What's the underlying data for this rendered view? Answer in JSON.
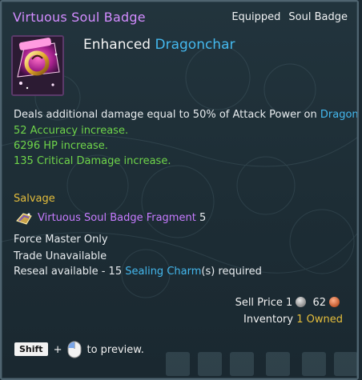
{
  "header": {
    "title": "Virtuous Soul Badge",
    "status": "Equipped",
    "type": "Soul Badge"
  },
  "item": {
    "prefix": "Enhanced",
    "name_highlight": "Dragonchar",
    "icon": "soul-badge-icon"
  },
  "effects": {
    "description_prefix": "Deals additional damage equal to 50% of Attack Power on",
    "description_highlight": "Dragonchar",
    "stats": [
      "52 Accuracy increase.",
      "6296 HP increase.",
      "135 Critical Damage increase."
    ]
  },
  "salvage": {
    "label": "Salvage",
    "item_name": "Virtuous Soul Badge Fragment",
    "count": "5",
    "icon": "fragment-icon"
  },
  "restrictions": {
    "class": "Force Master Only",
    "trade": "Trade Unavailable",
    "reseal_prefix": "Reseal available - 15",
    "reseal_item": "Sealing Charm",
    "reseal_suffix": "(s) required"
  },
  "price": {
    "label": "Sell Price",
    "silver": "1",
    "copper": "62"
  },
  "inventory": {
    "label": "Inventory",
    "owned": "1 Owned"
  },
  "preview": {
    "key": "Shift",
    "plus": "+",
    "text": "to preview."
  },
  "colors": {
    "title_purple": "#d38cff",
    "highlight_blue": "#44b8ee",
    "stat_green": "#6fd54a",
    "salvage_gold": "#e5be3c",
    "fragment_purple": "#c77bff",
    "background": "#1d2d35"
  }
}
